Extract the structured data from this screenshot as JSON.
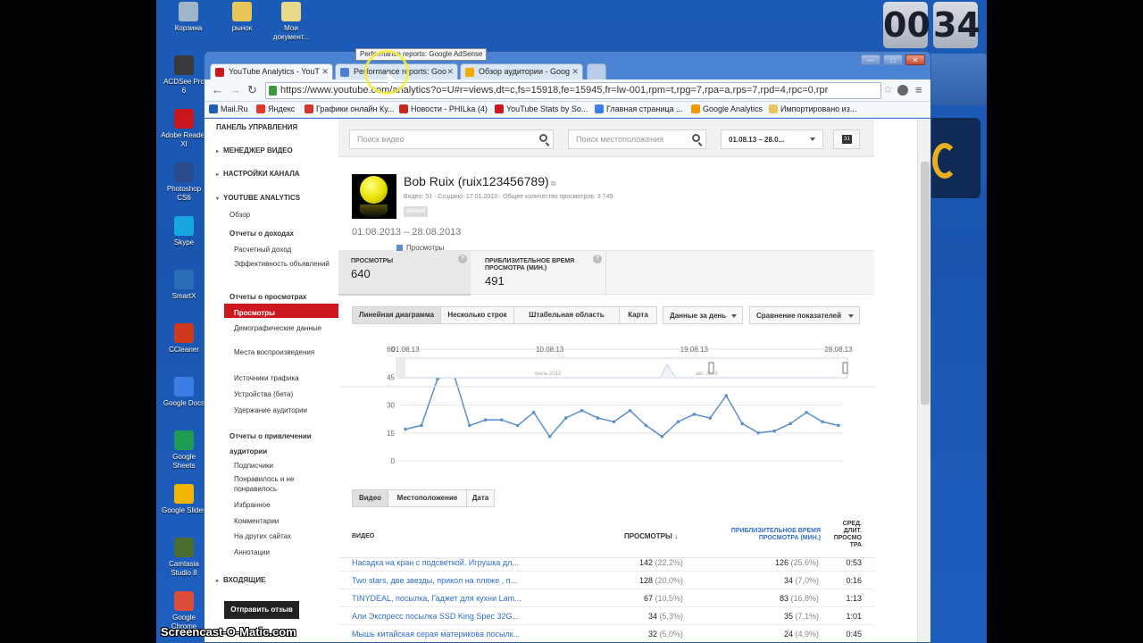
{
  "desktop": {
    "icons": [
      {
        "label": "Корзина",
        "color": "#9fb6c9"
      },
      {
        "label": "рынок",
        "color": "#e8c65a"
      },
      {
        "label": "Мои документ...",
        "color": "#e8d98a"
      },
      {
        "label": "ACDSee Pro 6",
        "color": "#3a3a3a"
      },
      {
        "label": "Adobe Reader XI",
        "color": "#c8161d"
      },
      {
        "label": "Photoshop CS6",
        "color": "#2b4a8c"
      },
      {
        "label": "Skype",
        "color": "#18a8e0"
      },
      {
        "label": "SmartX",
        "color": "#2a6fb5"
      },
      {
        "label": "CCleaner",
        "color": "#d0391e"
      },
      {
        "label": "Google Docs",
        "color": "#3d7ee6"
      },
      {
        "label": "Google Sheets",
        "color": "#1e9c54"
      },
      {
        "label": "Google Slides",
        "color": "#f2b500"
      },
      {
        "label": "Camtasia Studio 8",
        "color": "#4a6d2f"
      },
      {
        "label": "Google Chrome",
        "color": "#dd4b39"
      }
    ],
    "clock": {
      "hours": "00",
      "minutes": "34"
    },
    "watermark": "Screencast-O-Matic.com"
  },
  "browser": {
    "tabs": [
      {
        "label": "YouTube Analytics - YouT",
        "color": "#cc181e"
      },
      {
        "label": "Performance reports: Goo",
        "color": "#4a7fd1"
      },
      {
        "label": "Обзор аудитории - Goog",
        "color": "#f2a900"
      }
    ],
    "tooltip": "Performance reports: Google AdSense",
    "url": "https://www.youtube.com/analytics?o=U#r=views,dt=c,fs=15918,fe=15945,fr=lw-001,rpm=t,rpg=7,rpa=a,rps=7,rpd=4,rpc=0,rpr",
    "bookmarks": [
      {
        "label": "Mail.Ru",
        "color": "#1f5fb4"
      },
      {
        "label": "Яндекс",
        "color": "#e03a2a"
      },
      {
        "label": "Графики онлайн Ку...",
        "color": "#d8352a"
      },
      {
        "label": "Новости - PHILka (4)",
        "color": "#c8281e"
      },
      {
        "label": "YouTube Stats by So...",
        "color": "#cc181e"
      },
      {
        "label": "Главная страница ...",
        "color": "#3d7ee6"
      },
      {
        "label": "Google Analytics",
        "color": "#f29900"
      },
      {
        "label": "Импортировано из...",
        "color": "#e8c65a"
      }
    ]
  },
  "sidebar": {
    "dashboard": "ПАНЕЛЬ УПРАВЛЕНИЯ",
    "video_manager": "МЕНЕДЖЕР ВИДЕО",
    "channel_settings": "НАСТРОЙКИ КАНАЛА",
    "analytics": "YOUTUBE ANALYTICS",
    "overview": "Обзор",
    "revenue_group": "Отчеты о доходах",
    "revenue_items": [
      "Расчетный доход",
      "Эффективность объявлений"
    ],
    "views_group": "Отчеты о просмотрах",
    "views_items": [
      "Просмотры",
      "Демографические данные",
      "Места воспроизведения",
      "Источники трафика",
      "Устройства (бета)",
      "Удержание аудитории"
    ],
    "engagement_group": "Отчеты о привлечении аудитории",
    "engagement_items": [
      "Подписчики",
      "Понравилось и не понравилось",
      "Избранное",
      "Комментарии",
      "На других сайтах",
      "Аннотации"
    ],
    "inbox": "ВХОДЯЩИЕ",
    "feedback": "Отправить отзыв"
  },
  "filters": {
    "video_search": "Поиск видео",
    "location_search": "Поиск местоположения",
    "date_range": "01.08.13 – 28.0..."
  },
  "channel": {
    "name": "Bob Ruix (ruix123456789)",
    "meta": "Видео: 51 · Создано: 17.01.2013 · Общее количество просмотров: 3 749",
    "badge": "КАНАЛ",
    "period": "01.08.2013 – 28.08.2013"
  },
  "metrics": [
    {
      "label": "ПРОСМОТРЫ",
      "value": "640"
    },
    {
      "label": "ПРИБЛИЗИТЕЛЬНОЕ ВРЕМЯ ПРОСМОТРА (МИН.)",
      "value": "491"
    }
  ],
  "view_tabs": [
    "Линейная диаграмма",
    "Несколько строк",
    "Штабельная область",
    "Карта"
  ],
  "dropdowns": {
    "daily": "Данные за день",
    "compare": "Сравнение показателей"
  },
  "chart_data": {
    "type": "line",
    "legend": "Просмотры",
    "series": [
      {
        "name": "Просмотры",
        "values": [
          17,
          19,
          44,
          47,
          19,
          22,
          22,
          19,
          26,
          13,
          23,
          27,
          23,
          21,
          27,
          19,
          13,
          21,
          25,
          23,
          35,
          20,
          15,
          16,
          20,
          26,
          21,
          19
        ]
      }
    ],
    "x_tick_labels": [
      "01.08.13",
      "10.08.13",
      "19.08.13",
      "28.08.13"
    ],
    "yticks": [
      0,
      15,
      30,
      45,
      60
    ],
    "ylim": [
      0,
      60
    ],
    "navigator_labels": [
      "июль 2013",
      "авг. 2013"
    ]
  },
  "bottom_tabs": [
    "Видео",
    "Местоположение",
    "Дата"
  ],
  "table": {
    "headers": {
      "video": "ВИДЕО",
      "views": "ПРОСМОТРЫ ↓",
      "watch_time": "ПРИБЛИЗИТЕЛЬНОЕ ВРЕМЯ ПРОСМОТРА (МИН.)",
      "avg": "СРЕД. ДЛИТ. ПРОСМО ТРА"
    },
    "rows": [
      {
        "title": "Насадка на кран с подсветкой. Игрушка дл...",
        "views": "142",
        "views_pct": "(22,2%)",
        "time": "126",
        "time_pct": "(25,6%)",
        "avg": "0:53"
      },
      {
        "title": "Two stars, две звезды, прикол на пляже , п...",
        "views": "128",
        "views_pct": "(20,0%)",
        "time": "34",
        "time_pct": "(7,0%)",
        "avg": "0:16"
      },
      {
        "title": "TINYDEAL, посылка, Гаджет для кухни Lam...",
        "views": "67",
        "views_pct": "(10,5%)",
        "time": "83",
        "time_pct": "(16,8%)",
        "avg": "1:13"
      },
      {
        "title": "Али Экспресс посылка SSD King Spec 32G...",
        "views": "34",
        "views_pct": "(5,3%)",
        "time": "35",
        "time_pct": "(7,1%)",
        "avg": "1:01"
      },
      {
        "title": "Мышь китайская серая материкова посылк...",
        "views": "32",
        "views_pct": "(5,0%)",
        "time": "24",
        "time_pct": "(4,9%)",
        "avg": "0:45"
      }
    ]
  }
}
